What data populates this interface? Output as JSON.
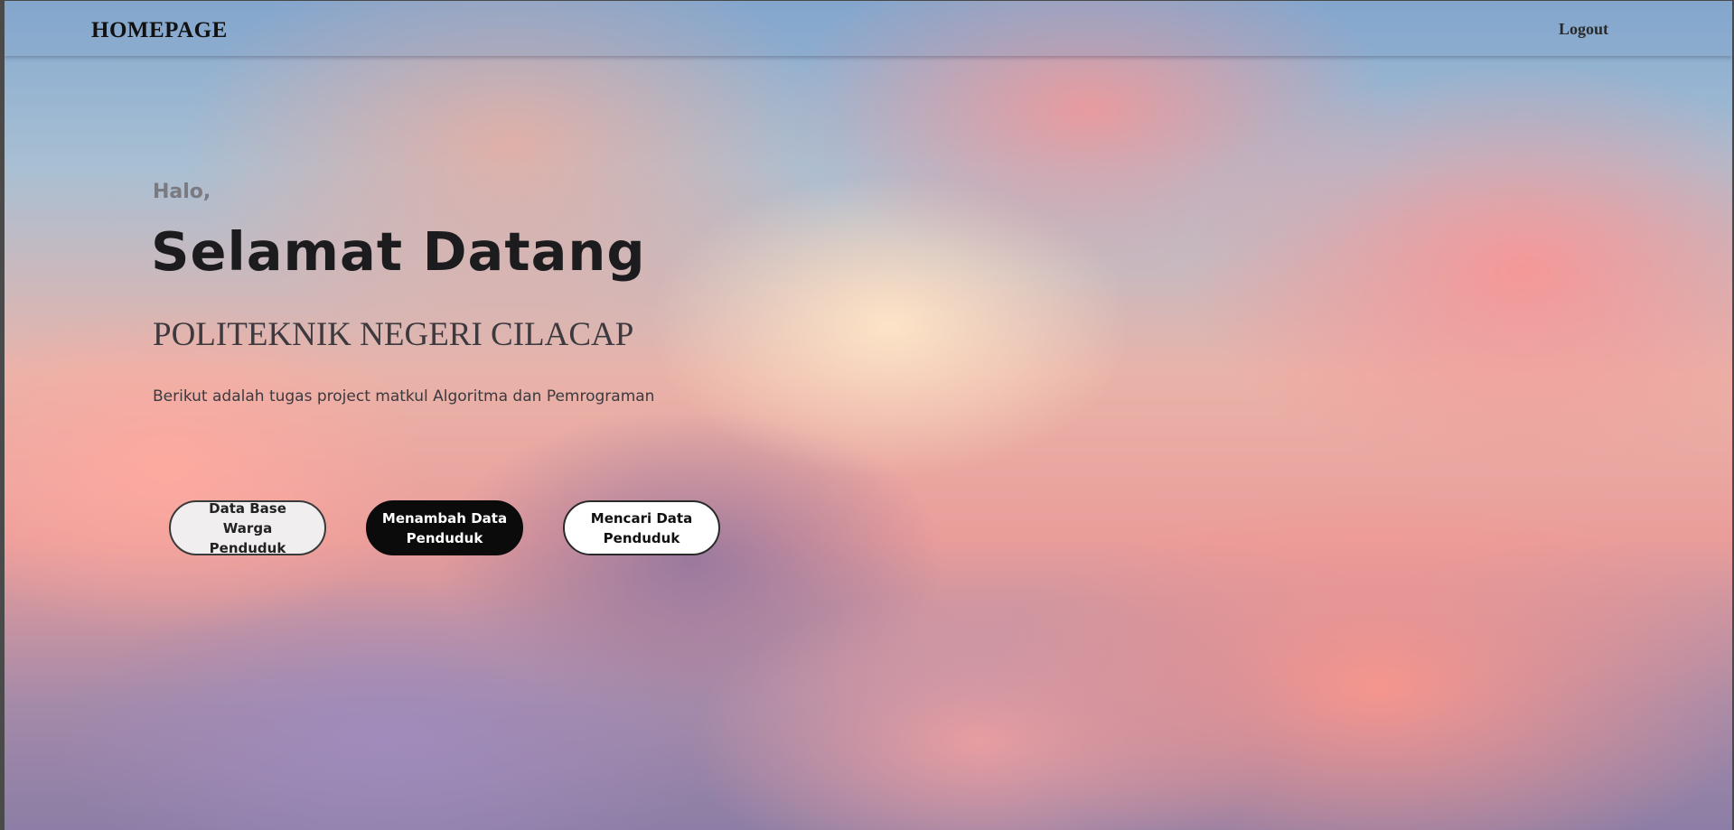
{
  "navbar": {
    "brand": "HOMEPAGE",
    "logout_label": "Logout"
  },
  "hero": {
    "greeting": "Halo,",
    "title": "Selamat Datang",
    "subtitle": "POLITEKNIK NEGERI CILACAP",
    "description": "Berikut adalah tugas project matkul Algoritma dan Pemrograman"
  },
  "actions": {
    "database_label": "Data Base Warga Penduduk",
    "add_label": "Menambah Data Penduduk",
    "search_label": "Mencari Data Penduduk"
  },
  "colors": {
    "primary_dark": "#0b0b0b",
    "light_button": "#f1eeef",
    "sky_blue": "#84a9cf",
    "cloud_pink": "#ea9d9a"
  }
}
